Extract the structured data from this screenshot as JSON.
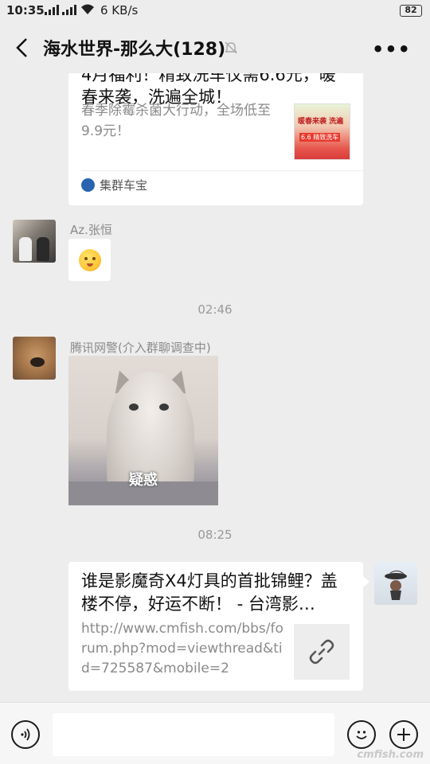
{
  "status_bar": {
    "time": "10:35",
    "network_1": "4G",
    "network_2": "4G",
    "speed": "6 KB/s",
    "battery": "82"
  },
  "header": {
    "title": "海水世界-那么大(128)"
  },
  "messages": {
    "share_card_1": {
      "headline": "4月福利！精致洗车仅需6.6元，暖春来袭，洗遍全城！",
      "description": "春季除霉杀菌大行动，全场低至9.9元！",
      "thumb_title": "暖春来袭 洗遍",
      "thumb_promo": "6.6 精致洗车",
      "source": "集群车宝"
    },
    "sender_1": "Az.张恒",
    "timestamp_1": "02:46",
    "sender_2": "腾讯网警(介入群聊调查中)",
    "sticker_caption": "疑惑",
    "timestamp_2": "08:25",
    "share_card_2": {
      "headline": "谁是影魔奇X4灯具的首批锦鲤？盖楼不停，好运不断！ - 台湾影…",
      "url": "http://www.cmfish.com/bbs/forum.php?mod=viewthread&tid=725587&mobile=2"
    }
  },
  "watermark": "cmfish.com",
  "colors": {
    "background": "#ededed",
    "bubble": "#ffffff",
    "meta_text": "#8a8a8a"
  }
}
